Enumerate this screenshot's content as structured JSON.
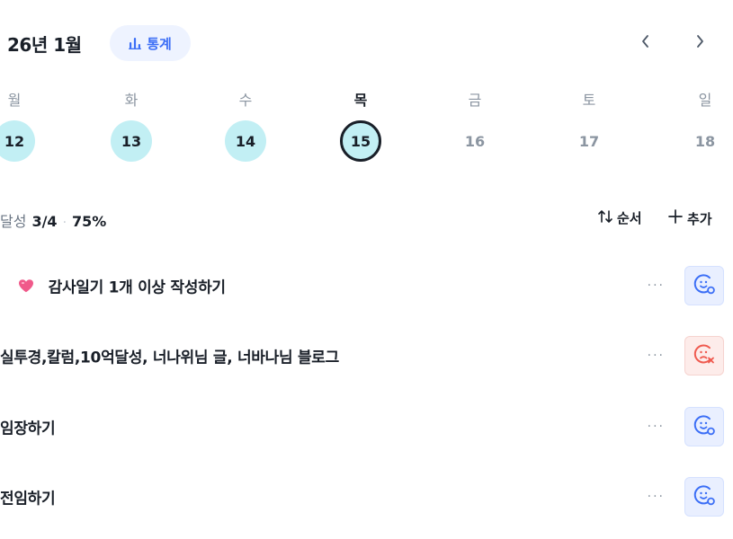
{
  "header": {
    "title": "26년 1월",
    "stats_label": "통계",
    "stats_icon": "bar-chart-icon",
    "prev_icon": "chevron-left-icon",
    "next_icon": "chevron-right-icon"
  },
  "week": {
    "days": [
      {
        "dow": "월",
        "date": "12",
        "state": "filled"
      },
      {
        "dow": "화",
        "date": "13",
        "state": "filled"
      },
      {
        "dow": "수",
        "date": "14",
        "state": "filled"
      },
      {
        "dow": "목",
        "date": "15",
        "state": "today"
      },
      {
        "dow": "금",
        "date": "16",
        "state": "plain"
      },
      {
        "dow": "토",
        "date": "17",
        "state": "plain"
      },
      {
        "dow": "일",
        "date": "18",
        "state": "plain"
      }
    ],
    "filled_color": "#c2eff4"
  },
  "summary": {
    "label": "달성",
    "count": "3/4",
    "separator": "·",
    "percent": "75%",
    "progress_fraction": 0.75
  },
  "toolbar": {
    "order_label": "순서",
    "order_icon": "sort-arrows-icon",
    "add_label": "추가",
    "add_icon": "plus-icon"
  },
  "habits": [
    {
      "label": "감사일기 1개 이상 작성하기",
      "icon": "heart-icon",
      "status": "good"
    },
    {
      "label": "실투경,칼럼,10억달성, 너나위님 글, 너바나님 블로그",
      "icon": "",
      "status": "bad"
    },
    {
      "label": "임장하기",
      "icon": "",
      "status": "good"
    },
    {
      "label": "전임하기",
      "icon": "",
      "status": "good"
    }
  ],
  "more_label": "···",
  "colors": {
    "accent": "#3b6ef6",
    "success_bg": "#e9efff",
    "fail": "#ef5a4f",
    "fail_bg": "#fdecea",
    "heart": "#f0598a"
  }
}
